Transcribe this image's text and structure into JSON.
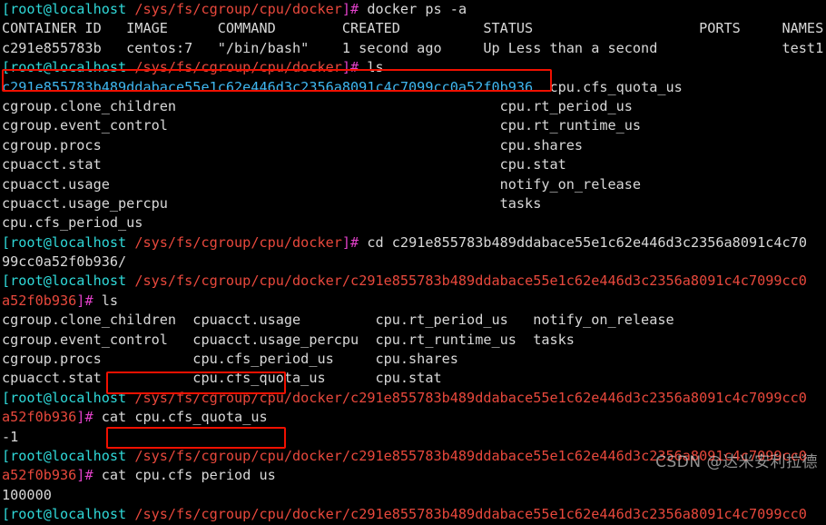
{
  "terminal": {
    "title": "root@localhost terminal",
    "colors": {
      "background": "#000000",
      "foreground": "#d8d8d8",
      "prompt_user": "#2fd8d8",
      "prompt_bracket": "#e040c8",
      "prompt_path": "#e8483c",
      "container_id": "#3fb7f0",
      "highlight_box": "#f01000"
    },
    "prompt": {
      "user_host": "[root@localhost",
      "terminator": "]#"
    },
    "paths": {
      "docker_dir": "/sys/fs/cgroup/cpu/docker",
      "container_dir_line1": "/sys/fs/cgroup/cpu/docker/c291e855783b489ddabace55e1c62e446d3c2356a8091c4c7099cc0",
      "container_dir_line2": "a52f0b936"
    },
    "container": {
      "short_id": "c291e855783b",
      "full_id": "c291e855783b489ddabace55e1c62e446d3c2356a8091c4c7099cc0a52f0b936",
      "full_id_wrap_1": "c291e855783b489ddabace55e1c62e446d3c2356a8091c4c70",
      "full_id_wrap_2": "99cc0a52f0b936/"
    },
    "commands": {
      "docker_ps": "docker ps -a",
      "ls": "ls",
      "cd": "cd c291e855783b489ddabace55e1c62e446d3c2356a8091c4c70",
      "cat_quota": "cat cpu.cfs_quota_us",
      "cat_period": "cat cpu.cfs period us"
    },
    "docker_ps_table": {
      "headers": [
        "CONTAINER ID",
        "IMAGE",
        "COMMAND",
        "CREATED",
        "STATUS",
        "PORTS",
        "NAMES"
      ],
      "header_line": "CONTAINER ID   IMAGE      COMMAND        CREATED          STATUS                    PORTS     NAMES",
      "row_line": "c291e855783b   centos:7   \"/bin/bash\"    1 second ago     Up Less than a second               test1",
      "rows": [
        {
          "container_id": "c291e855783b",
          "image": "centos:7",
          "command": "\"/bin/bash\"",
          "created": "1 second ago",
          "status": "Up Less than a second",
          "ports": "",
          "names": "test1"
        }
      ]
    },
    "ls_output_1": {
      "left_column": [
        "cgroup.clone_children",
        "cgroup.event_control",
        "cgroup.procs",
        "cpuacct.stat",
        "cpuacct.usage",
        "cpuacct.usage_percpu",
        "cpu.cfs_period_us"
      ],
      "right_column": [
        "cpu.cfs_quota_us",
        "cpu.rt_period_us",
        "cpu.rt_runtime_us",
        "cpu.shares",
        "cpu.stat",
        "notify_on_release",
        "tasks"
      ],
      "rows": [
        "                                                            cpu.cfs_quota_us",
        "cgroup.clone_children                                       cpu.rt_period_us",
        "cgroup.event_control                                        cpu.rt_runtime_us",
        "cgroup.procs                                                cpu.shares",
        "cpuacct.stat                                                cpu.stat",
        "cpuacct.usage                                               notify_on_release",
        "cpuacct.usage_percpu                                        tasks",
        "cpu.cfs_period_us"
      ]
    },
    "ls_output_2": {
      "rows": [
        "cgroup.clone_children  cpuacct.usage         cpu.rt_period_us   notify_on_release",
        "cgroup.event_control   cpuacct.usage_percpu  cpu.rt_runtime_us  tasks",
        "cgroup.procs           cpu.cfs_period_us     cpu.shares",
        "cpuacct.stat           cpu.cfs_quota_us      cpu.stat"
      ],
      "columns": [
        [
          "cgroup.clone_children",
          "cgroup.event_control",
          "cgroup.procs",
          "cpuacct.stat"
        ],
        [
          "cpuacct.usage",
          "cpuacct.usage_percpu",
          "cpu.cfs_period_us",
          "cpu.cfs_quota_us"
        ],
        [
          "cpu.rt_period_us",
          "cpu.rt_runtime_us",
          "cpu.shares",
          "cpu.stat"
        ],
        [
          "notify_on_release",
          "tasks"
        ]
      ]
    },
    "cat_results": {
      "cpu_cfs_quota_us": "-1",
      "cpu_cfs_period_us": "100000"
    }
  },
  "watermark": {
    "text": "CSDN @达米安利拉德"
  }
}
